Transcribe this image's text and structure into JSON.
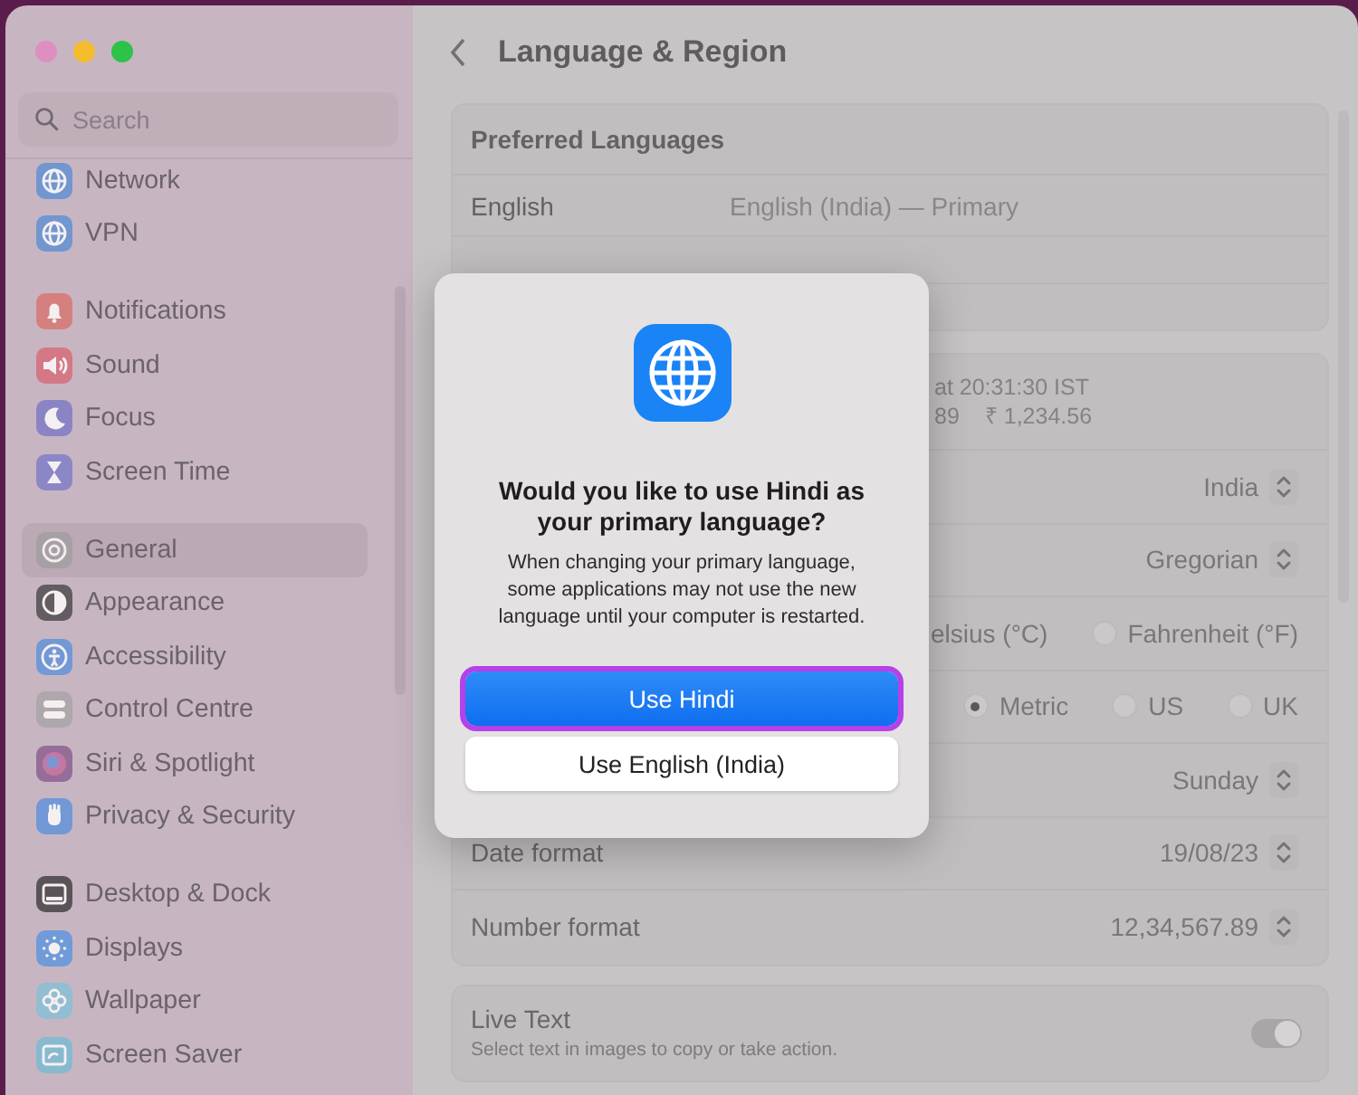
{
  "sidebar": {
    "search": {
      "placeholder": "Search"
    },
    "groups": [
      [
        {
          "label": "Network",
          "selected": false
        },
        {
          "label": "VPN",
          "selected": false
        }
      ],
      [
        {
          "label": "Notifications",
          "selected": false
        },
        {
          "label": "Sound",
          "selected": false
        },
        {
          "label": "Focus",
          "selected": false
        },
        {
          "label": "Screen Time",
          "selected": false
        }
      ],
      [
        {
          "label": "General",
          "selected": true
        },
        {
          "label": "Appearance",
          "selected": false
        },
        {
          "label": "Accessibility",
          "selected": false
        },
        {
          "label": "Control Centre",
          "selected": false
        },
        {
          "label": "Siri & Spotlight",
          "selected": false
        },
        {
          "label": "Privacy & Security",
          "selected": false
        }
      ],
      [
        {
          "label": "Desktop & Dock",
          "selected": false
        },
        {
          "label": "Displays",
          "selected": false
        },
        {
          "label": "Wallpaper",
          "selected": false
        },
        {
          "label": "Screen Saver",
          "selected": false
        }
      ]
    ]
  },
  "main": {
    "title": "Language & Region",
    "preferred_languages": {
      "heading": "Preferred Languages",
      "rows": [
        {
          "language": "English",
          "detail": "English (India) — Primary"
        }
      ]
    },
    "region_summary": {
      "lines": [
        [
          "at 20:31:30 IST"
        ],
        [
          "89",
          "₹ 1,234.56"
        ]
      ]
    },
    "settings": [
      {
        "kind": "popup",
        "value": "India"
      },
      {
        "kind": "popup",
        "value": "Gregorian"
      },
      {
        "kind": "radios",
        "partial_label": "elsius (°C)",
        "options": [
          {
            "label": "Fahrenheit (°F)",
            "selected": false
          }
        ]
      },
      {
        "kind": "radios",
        "options": [
          {
            "label": "Metric",
            "selected": true
          },
          {
            "label": "US",
            "selected": false
          },
          {
            "label": "UK",
            "selected": false
          }
        ]
      },
      {
        "kind": "popup",
        "value": "Sunday"
      },
      {
        "kind": "popup",
        "label": "Date format",
        "value": "19/08/23"
      },
      {
        "kind": "popup",
        "label": "Number format",
        "value": "12,34,567.89"
      }
    ],
    "live_text": {
      "title": "Live Text",
      "subtitle": "Select text in images to copy or take action.",
      "on": true
    }
  },
  "dialog": {
    "title": "Would you like to use Hindi as your primary language?",
    "message": "When changing your primary language, some applications may not use the new language until your computer is restarted.",
    "buttons": [
      {
        "label": "Use Hindi",
        "kind": "primary",
        "highlighted": true
      },
      {
        "label": "Use English (India)",
        "kind": "secondary",
        "highlighted": false
      }
    ]
  }
}
